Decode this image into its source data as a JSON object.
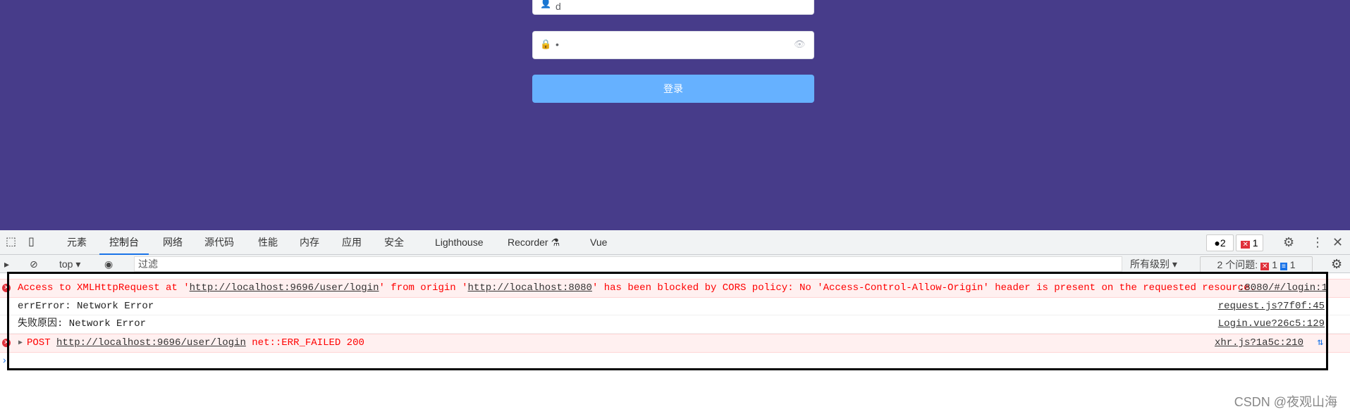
{
  "login": {
    "username_value": "d",
    "password_value": "•",
    "submit_label": "登录"
  },
  "devtools": {
    "tabs": [
      {
        "label": "元素"
      },
      {
        "label": "控制台"
      },
      {
        "label": "网络"
      },
      {
        "label": "源代码"
      },
      {
        "label": "性能"
      },
      {
        "label": "内存"
      },
      {
        "label": "应用"
      },
      {
        "label": "安全"
      },
      {
        "label": "Lighthouse"
      },
      {
        "label": "Recorder"
      },
      {
        "label": "Vue"
      }
    ],
    "active_tab": "控制台",
    "messages_count": "2",
    "errors_count": "1",
    "toolbar": {
      "context": "top",
      "filter_placeholder": "过滤",
      "levels": "所有级别",
      "issues_label": "2 个问题:",
      "issues_errors": "1",
      "issues_info": "1"
    },
    "console": [
      {
        "type": "error",
        "parts": {
          "a": "Access to XMLHttpRequest at '",
          "url1": "http://localhost:9696/user/login",
          "b": "' from origin '",
          "url2": "http://localhost:8080",
          "c": "' has been blocked by CORS policy: No 'Access-Control-Allow-Origin' header is present on the requested resource."
        },
        "source": ":8080/#/login:1"
      },
      {
        "type": "log",
        "text": "errError: Network Error",
        "source": "request.js?7f0f:45"
      },
      {
        "type": "log",
        "text": "失败原因: Network Error",
        "source": "Login.vue?26c5:129"
      },
      {
        "type": "error",
        "parts": {
          "a": "POST ",
          "url1": "http://localhost:9696/user/login",
          "b": " net::ERR_FAILED 200"
        },
        "source": "xhr.js?1a5c:210"
      }
    ]
  },
  "watermark": "CSDN @夜观山海",
  "colors": {
    "page_bg": "#473c8a",
    "button": "#66b1ff",
    "error_text": "#ff0000",
    "error_bg": "#fff0f0",
    "active_tab": "#1a73e8"
  }
}
